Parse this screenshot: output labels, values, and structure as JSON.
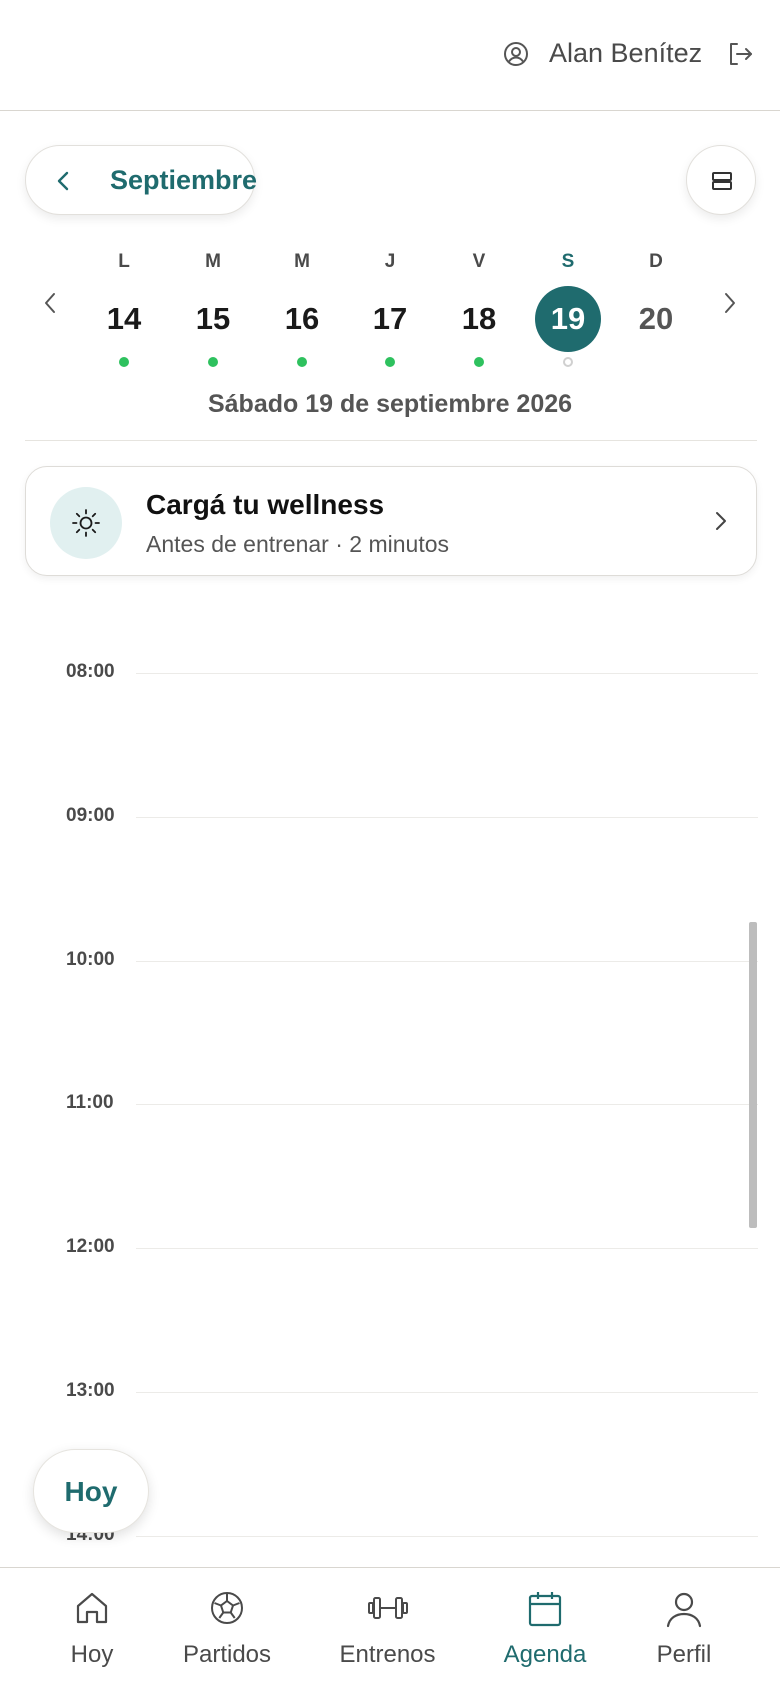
{
  "header": {
    "user_name": "Alan Benítez"
  },
  "calendar": {
    "month": "Septiembre",
    "days": [
      {
        "letter": "L",
        "number": "14"
      },
      {
        "letter": "M",
        "number": "15"
      },
      {
        "letter": "M",
        "number": "16"
      },
      {
        "letter": "J",
        "number": "17"
      },
      {
        "letter": "V",
        "number": "18"
      },
      {
        "letter": "S",
        "number": "19"
      },
      {
        "letter": "D",
        "number": "20"
      }
    ],
    "selected_date": "Sábado 19 de septiembre 2026"
  },
  "wellness": {
    "title": "Cargá tu wellness",
    "subtitle": "Antes de entrenar · 2 minutos",
    "icon": "sun-icon"
  },
  "schedule": {
    "hours": [
      "08:00",
      "09:00",
      "10:00",
      "11:00",
      "12:00",
      "13:00",
      "14:00"
    ]
  },
  "today_button": "Hoy",
  "nav": {
    "items": [
      {
        "label": "Hoy",
        "icon": "home-icon"
      },
      {
        "label": "Partidos",
        "icon": "soccer-ball-icon"
      },
      {
        "label": "Entrenos",
        "icon": "dumbbell-icon"
      },
      {
        "label": "Agenda",
        "icon": "calendar-icon"
      },
      {
        "label": "Perfil",
        "icon": "user-icon"
      }
    ],
    "active": "Agenda"
  },
  "colors": {
    "accent": "#1f6b6e",
    "event_dot": "#2ec15e"
  }
}
